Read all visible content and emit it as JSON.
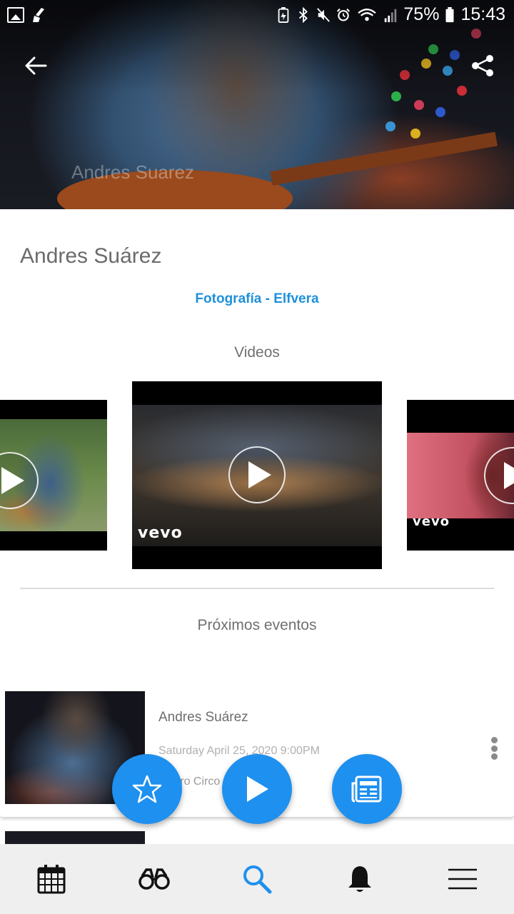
{
  "status_bar": {
    "battery_percent": "75%",
    "time": "15:43",
    "icons": [
      "image-icon",
      "cleaner-icon",
      "battery-saver-icon",
      "bluetooth-icon",
      "mute-icon",
      "alarm-icon",
      "wifi-icon",
      "signal-icon",
      "battery-icon"
    ]
  },
  "hero": {
    "watermark": "Andres Suarez"
  },
  "artist": {
    "name": "Andres Suárez",
    "photo_credit": "Fotografía - Elfvera"
  },
  "videos": {
    "title": "Videos",
    "items": [
      {
        "brand": ""
      },
      {
        "brand": "vevo"
      },
      {
        "brand": "vevo"
      }
    ]
  },
  "events": {
    "title": "Próximos eventos",
    "items": [
      {
        "title": "Andres Suárez",
        "date": "Saturday April 25, 2020 9:00PM",
        "venue": "Teatro Circo"
      }
    ]
  },
  "fabs": [
    "star-icon",
    "play-icon",
    "newspaper-icon"
  ],
  "bottom_nav": [
    "calendar-icon",
    "binoculars-icon",
    "search-icon",
    "bell-icon",
    "menu-icon"
  ],
  "colors": {
    "accent": "#1e90ef",
    "link": "#1e90db",
    "text_primary": "#6b6b6b",
    "nav_bg": "#efefef"
  }
}
